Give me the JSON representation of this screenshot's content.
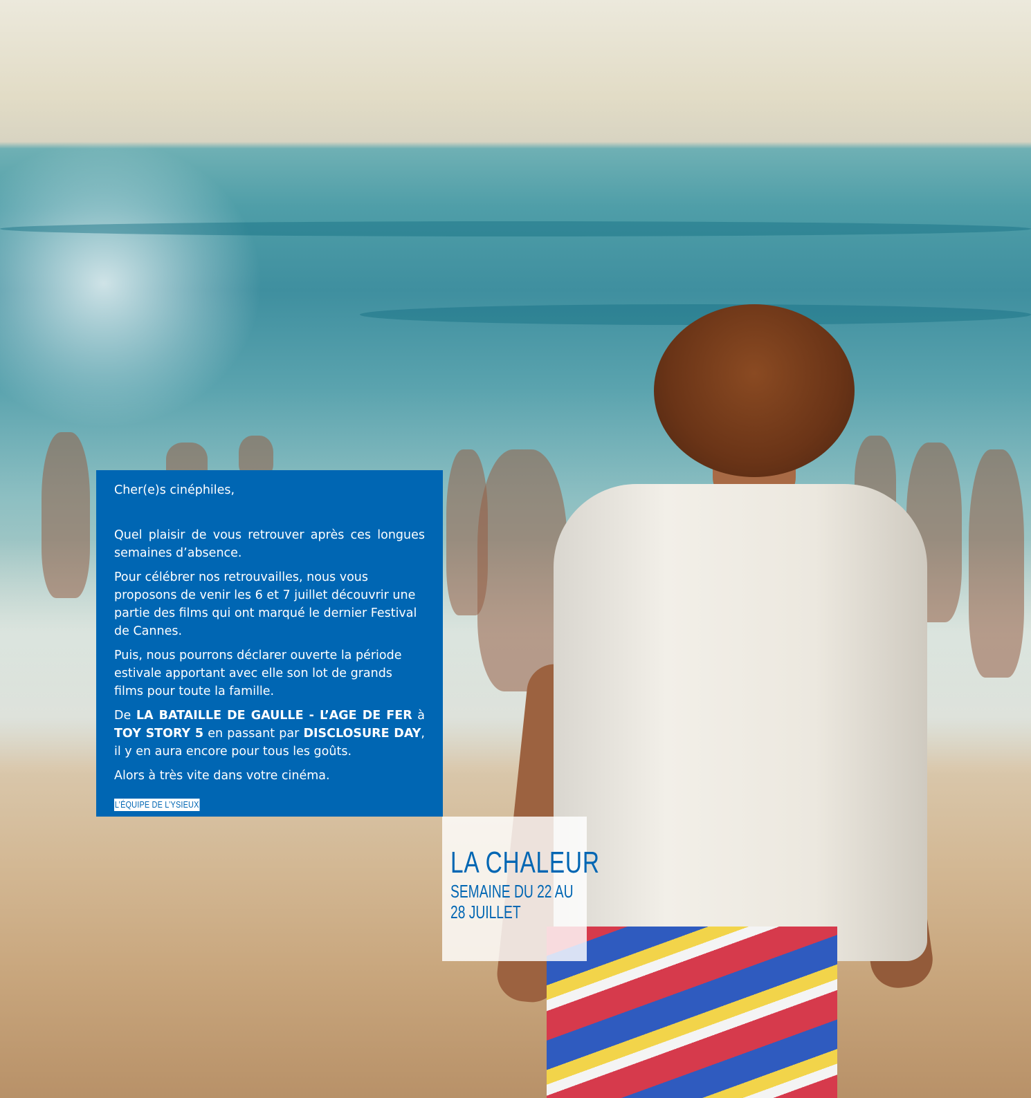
{
  "letter": {
    "greeting": "Cher(e)s cinéphiles,",
    "paragraph_1": "Quel plaisir de vous retrouver après ces longues semaines d’absence.",
    "paragraph_2": "Pour célébrer nos retrouvailles, nous vous proposons de venir les 6 et 7 juillet découvrir une partie des films qui ont marqué le dernier Festival de Cannes.",
    "paragraph_3": "Puis, nous pourrons déclarer ouverte la période estivale apportant avec elle son lot de grands films pour toute la famille.",
    "paragraph_4": {
      "lead": "De",
      "film_1": "LA BATAILLE DE GAULLE - L’AGE DE FER",
      "connector_1": "à",
      "film_2": "TOY STORY 5",
      "connector_2": "en passant par",
      "film_3": "DISCLOSURE DAY",
      "tail": ", il y en aura encore pour tous les goûts."
    },
    "paragraph_5": "Alors à très vite dans votre cinéma.",
    "signature": "L’ÉQUIPE DE L’YSIEUX"
  },
  "film_box": {
    "title": "LA CHALEUR",
    "week": "SEMAINE DU 22 AU 28 JUILLET"
  },
  "colors": {
    "brand_blue": "#0066b3",
    "text_on_blue": "#ffffff",
    "box_background": "#ffffff"
  }
}
